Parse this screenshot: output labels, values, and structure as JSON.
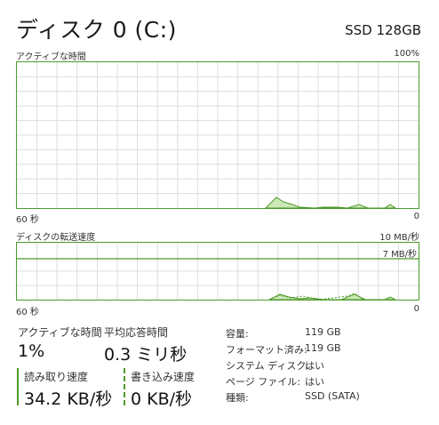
{
  "header": {
    "title": "ディスク 0 (C:)",
    "device_model": "SSD 128GB"
  },
  "graph_active": {
    "label": "アクティブな時間",
    "max_label": "100%",
    "left_axis": "60 秒",
    "right_axis": "0"
  },
  "graph_speed": {
    "label": "ディスクの転送速度",
    "max_label": "10 MB/秒",
    "line_label": "7 MB/秒",
    "left_axis": "60 秒",
    "right_axis": "0"
  },
  "stats": {
    "active_time": {
      "label": "アクティブな時間",
      "value": "1%"
    },
    "avg_response": {
      "label": "平均応答時間",
      "value": "0.3 ミリ秒"
    },
    "read_speed": {
      "label": "読み取り速度",
      "value": "34.2 KB/秒"
    },
    "write_speed": {
      "label": "書き込み速度",
      "value": "0 KB/秒"
    }
  },
  "properties": [
    {
      "key": "容量:",
      "value": "119 GB"
    },
    {
      "key": "フォーマット済み:",
      "value": "119 GB"
    },
    {
      "key": "システム ディスク:",
      "value": "はい"
    },
    {
      "key": "ページ ファイル:",
      "value": "はい"
    },
    {
      "key": "種類:",
      "value": "SSD (SATA)"
    }
  ],
  "colors": {
    "accent": "#4c9a2a",
    "fill": "#cde8b8",
    "grid": "#dcdcdc"
  }
}
